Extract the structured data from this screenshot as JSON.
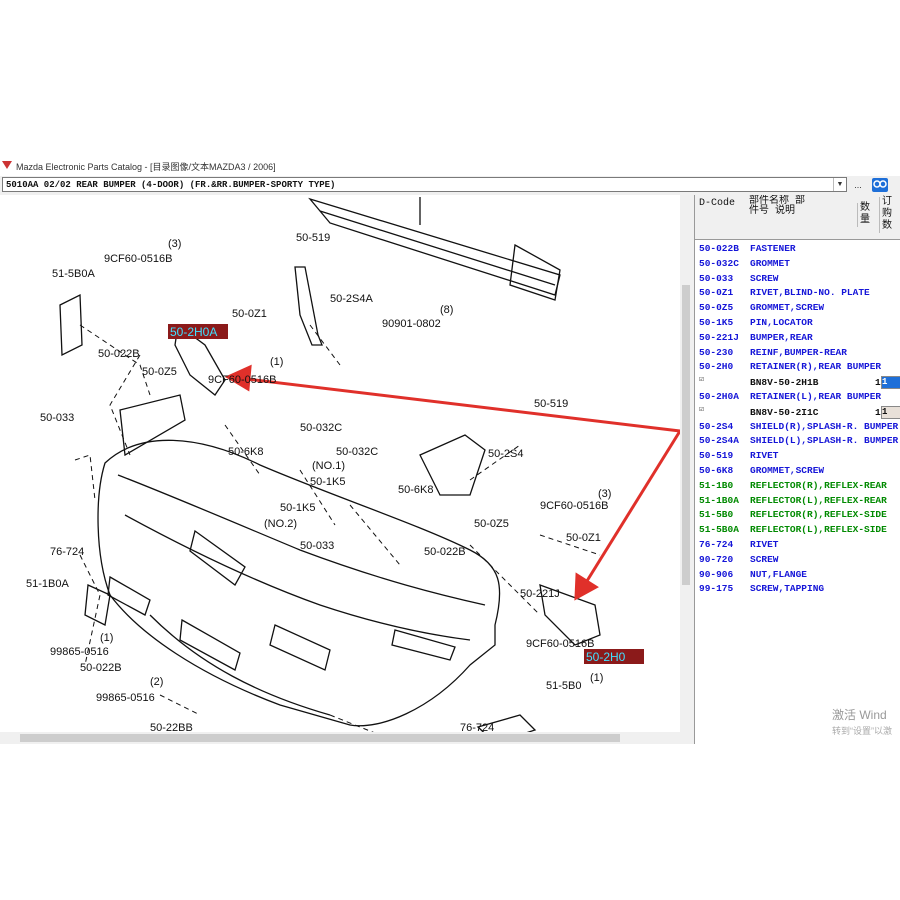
{
  "window": {
    "title": "Mazda Electronic Parts Catalog - [目录图像/文本MAZDA3 / 2006]"
  },
  "toolbar": {
    "combo_value": "5010AA 02/02 REAR BUMPER (4-DOOR) (FR.&RR.BUMPER-SPORTY TYPE)",
    "btn_dots": "...",
    "btn_icon": "link-icon"
  },
  "diagram": {
    "labels": [
      "50-519",
      "50-2S4A",
      "90901-0802",
      "(8)",
      "(3)",
      "9CF60-0516B",
      "51-5B0A",
      "50-2H0A",
      "50-0Z1",
      "50-022B",
      "50-0Z5",
      "(1)",
      "9CF60-0516B",
      "50-033",
      "50-6K8",
      "50-032C",
      "50-032C",
      "(NO.1)",
      "50-1K5",
      "50-6K8",
      "50-1K5",
      "(NO.2)",
      "50-033",
      "50-0Z5",
      "50-022B",
      "50-519",
      "50-2S4",
      "9CF60-0516B",
      "(3)",
      "50-0Z1",
      "76-724",
      "51-1B0A",
      "99865-0516",
      "(1)",
      "50-022B",
      "(2)",
      "99865-0516",
      "50-221J",
      "50-2H0",
      "(1)",
      "9CF60-0516B",
      "51-5B0",
      "76-724",
      "50-22BB"
    ]
  },
  "parts": {
    "headers": {
      "dcode": "D-Code",
      "name": "部件名称 部件号 说明",
      "qty": "数量",
      "order": "订购数"
    },
    "rows": [
      {
        "code": "50-022B",
        "name": "FASTENER",
        "color": "blue"
      },
      {
        "code": "50-032C",
        "name": "GROMMET",
        "color": "blue"
      },
      {
        "code": "50-033",
        "name": "SCREW",
        "color": "blue"
      },
      {
        "code": "50-0Z1",
        "name": "RIVET,BLIND-NO. PLATE",
        "color": "blue"
      },
      {
        "code": "50-0Z5",
        "name": "GROMMET,SCREW",
        "color": "blue"
      },
      {
        "code": "50-1K5",
        "name": "PIN,LOCATOR",
        "color": "blue"
      },
      {
        "code": "50-221J",
        "name": "BUMPER,REAR",
        "color": "blue"
      },
      {
        "code": "50-230",
        "name": "REINF,BUMPER-REAR",
        "color": "blue"
      },
      {
        "code": "50-2H0",
        "name": "RETAINER(R),REAR BUMPER",
        "color": "blue"
      },
      {
        "sub": true,
        "pn": "BN8V-50-2H1B",
        "qty": "1",
        "order": "1",
        "selected": true
      },
      {
        "code": "50-2H0A",
        "name": "RETAINER(L),REAR BUMPER",
        "color": "blue"
      },
      {
        "sub": true,
        "pn": "BN8V-50-2I1C",
        "qty": "1",
        "order": "1",
        "selected": false
      },
      {
        "code": "50-2S4",
        "name": "SHIELD(R),SPLASH-R. BUMPER",
        "color": "blue"
      },
      {
        "code": "50-2S4A",
        "name": "SHIELD(L),SPLASH-R. BUMPER",
        "color": "blue"
      },
      {
        "code": "50-519",
        "name": "RIVET",
        "color": "blue"
      },
      {
        "code": "50-6K8",
        "name": "GROMMET,SCREW",
        "color": "blue"
      },
      {
        "code": "51-1B0",
        "name": "REFLECTOR(R),REFLEX-REAR",
        "color": "green"
      },
      {
        "code": "51-1B0A",
        "name": "REFLECTOR(L),REFLEX-REAR",
        "color": "green"
      },
      {
        "code": "51-5B0",
        "name": "REFLECTOR(R),REFLEX-SIDE",
        "color": "green"
      },
      {
        "code": "51-5B0A",
        "name": "REFLECTOR(L),REFLEX-SIDE",
        "color": "green"
      },
      {
        "code": "76-724",
        "name": "RIVET",
        "color": "blue"
      },
      {
        "code": "90-720",
        "name": "SCREW",
        "color": "blue"
      },
      {
        "code": "90-906",
        "name": "NUT,FLANGE",
        "color": "blue"
      },
      {
        "code": "99-175",
        "name": "SCREW,TAPPING",
        "color": "blue"
      }
    ]
  },
  "watermark": {
    "line1": "激活 Wind",
    "line2": "转到“设置”以激"
  },
  "colors": {
    "highlight_bg": "#8b1a1a",
    "highlight_fg": "#40e0ff",
    "arrow": "#e0302a",
    "blue_text": "#1515d8",
    "green_text": "#008a00"
  }
}
